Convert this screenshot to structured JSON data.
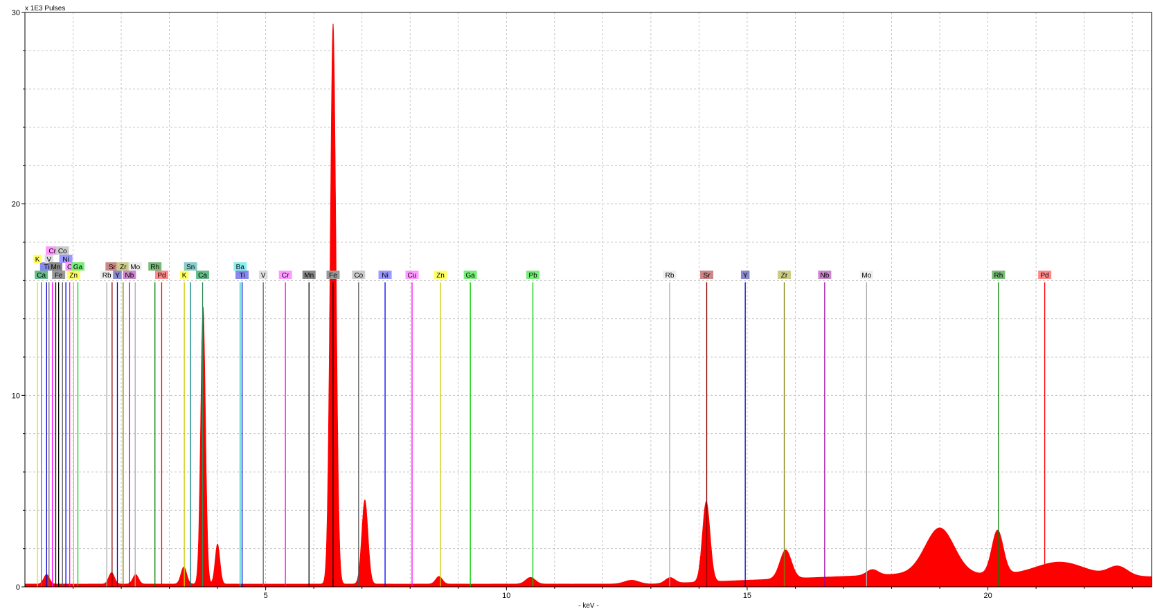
{
  "chart_data": {
    "type": "area",
    "y_unit_label": "x 1E3 Pulses",
    "xlabel": "- keV -",
    "xlim": [
      0.0,
      23.4
    ],
    "ylim": [
      0,
      30
    ],
    "x_ticks": [
      5,
      10,
      15,
      20
    ],
    "x_tick_labels": [
      "5",
      "10",
      "15",
      "20"
    ],
    "y_ticks": [
      0,
      10,
      20,
      30
    ],
    "y_tick_labels": [
      "0",
      "10",
      "20",
      "30"
    ],
    "grid": true,
    "series_color": "#ff0000",
    "spectrum": {
      "baseline": 0.15,
      "peaks": [
        {
          "x": 0.45,
          "height": 0.5,
          "width": 0.06
        },
        {
          "x": 1.8,
          "height": 0.6,
          "width": 0.06
        },
        {
          "x": 2.3,
          "height": 0.5,
          "width": 0.06
        },
        {
          "x": 3.3,
          "height": 0.9,
          "width": 0.06
        },
        {
          "x": 3.7,
          "height": 14.5,
          "width": 0.05
        },
        {
          "x": 4.0,
          "height": 2.1,
          "width": 0.05
        },
        {
          "x": 6.4,
          "height": 29.3,
          "width": 0.06
        },
        {
          "x": 7.06,
          "height": 4.4,
          "width": 0.065
        },
        {
          "x": 8.6,
          "height": 0.4,
          "width": 0.07
        },
        {
          "x": 10.5,
          "height": 0.35,
          "width": 0.1
        },
        {
          "x": 12.6,
          "height": 0.2,
          "width": 0.15
        },
        {
          "x": 13.4,
          "height": 0.3,
          "width": 0.1
        },
        {
          "x": 14.15,
          "height": 4.2,
          "width": 0.08
        },
        {
          "x": 15.8,
          "height": 1.5,
          "width": 0.12
        },
        {
          "x": 17.6,
          "height": 0.3,
          "width": 0.12
        },
        {
          "x": 19.0,
          "height": 2.4,
          "width": 0.3
        },
        {
          "x": 20.2,
          "height": 2.3,
          "width": 0.12
        },
        {
          "x": 21.5,
          "height": 0.7,
          "width": 0.5
        },
        {
          "x": 22.7,
          "height": 0.5,
          "width": 0.2
        }
      ],
      "hump": {
        "x_start": 13.0,
        "x_peak": 18.5,
        "x_end": 23.4,
        "height": 0.55
      }
    },
    "element_lines": [
      {
        "element": "Ca",
        "x": 0.34,
        "row": 3,
        "color": "#2e8b57",
        "label_bg": "#66bb88"
      },
      {
        "element": "Ti",
        "x": 0.45,
        "row": 2,
        "color": "#0000cd",
        "label_bg": "#8888ee"
      },
      {
        "element": "K",
        "x": 0.26,
        "row": 1,
        "color": "#e0e000",
        "label_bg": "#ffff66"
      },
      {
        "element": "V",
        "x": 0.5,
        "row": 1,
        "color": "#696969",
        "label_bg": "#dddddd"
      },
      {
        "element": "Cr",
        "x": 0.57,
        "row": 0,
        "color": "#ff00ff",
        "label_bg": "#ff99ff"
      },
      {
        "element": "Mn",
        "x": 0.64,
        "row": 2,
        "color": "#000000",
        "label_bg": "#888888"
      },
      {
        "element": "Fe",
        "x": 0.7,
        "row": 3,
        "color": "#000000",
        "label_bg": "#999999"
      },
      {
        "element": "Co",
        "x": 0.78,
        "row": 0,
        "color": "#555555",
        "label_bg": "#cccccc"
      },
      {
        "element": "Ni",
        "x": 0.85,
        "row": 1,
        "color": "#0000ff",
        "label_bg": "#9999ff"
      },
      {
        "element": "C",
        "x": 0.93,
        "row": 2,
        "color": "#ff00ff",
        "label_bg": "#ff99ff"
      },
      {
        "element": "Zn",
        "x": 1.01,
        "row": 3,
        "color": "#cccc00",
        "label_bg": "#ffff66"
      },
      {
        "element": "Ga",
        "x": 1.1,
        "row": 2,
        "color": "#00cc00",
        "label_bg": "#77ee77"
      },
      {
        "element": "Rb",
        "x": 1.7,
        "row": 3,
        "color": "#aaaaaa",
        "label_bg": "#eeeeee"
      },
      {
        "element": "Sr",
        "x": 1.81,
        "row": 2,
        "color": "#8b0000",
        "label_bg": "#cc8888"
      },
      {
        "element": "Y",
        "x": 1.92,
        "row": 3,
        "color": "#0000cd",
        "label_bg": "#8888cc"
      },
      {
        "element": "Zr",
        "x": 2.04,
        "row": 2,
        "color": "#808000",
        "label_bg": "#cccc88"
      },
      {
        "element": "Nb",
        "x": 2.17,
        "row": 3,
        "color": "#990099",
        "label_bg": "#cc88cc"
      },
      {
        "element": "Mo",
        "x": 2.29,
        "row": 2,
        "color": "#aaaaaa",
        "label_bg": "#eeeeee"
      },
      {
        "element": "Rh",
        "x": 2.7,
        "row": 2,
        "color": "#008000",
        "label_bg": "#77bb77"
      },
      {
        "element": "Pd",
        "x": 2.84,
        "row": 3,
        "color": "#ff0000",
        "label_bg": "#ff8888"
      },
      {
        "element": "K",
        "x": 3.31,
        "row": 3,
        "color": "#cccc00",
        "label_bg": "#ffff66"
      },
      {
        "element": "Sn",
        "x": 3.44,
        "row": 2,
        "color": "#008080",
        "label_bg": "#88cccc"
      },
      {
        "element": "Ca",
        "x": 3.69,
        "row": 3,
        "color": "#2e8b57",
        "label_bg": "#66bb88"
      },
      {
        "element": "Ba",
        "x": 4.47,
        "row": 2,
        "color": "#00cccc",
        "label_bg": "#88eeee"
      },
      {
        "element": "Ti",
        "x": 4.51,
        "row": 3,
        "color": "#0000cd",
        "label_bg": "#8888ee"
      },
      {
        "element": "V",
        "x": 4.95,
        "row": 3,
        "color": "#696969",
        "label_bg": "#dddddd"
      },
      {
        "element": "Cr",
        "x": 5.41,
        "row": 3,
        "color": "#ff00ff",
        "label_bg": "#ff99ff"
      },
      {
        "element": "Mn",
        "x": 5.9,
        "row": 3,
        "color": "#000000",
        "label_bg": "#888888"
      },
      {
        "element": "Fe",
        "x": 6.4,
        "row": 3,
        "color": "#000000",
        "label_bg": "#999999"
      },
      {
        "element": "Co",
        "x": 6.93,
        "row": 3,
        "color": "#555555",
        "label_bg": "#cccccc"
      },
      {
        "element": "Ni",
        "x": 7.48,
        "row": 3,
        "color": "#0000ff",
        "label_bg": "#9999ff"
      },
      {
        "element": "Cu",
        "x": 8.04,
        "row": 3,
        "color": "#ff00ff",
        "label_bg": "#ff99ff"
      },
      {
        "element": "Zn",
        "x": 8.63,
        "row": 3,
        "color": "#cccc00",
        "label_bg": "#ffff66"
      },
      {
        "element": "Ga",
        "x": 9.25,
        "row": 3,
        "color": "#00cc00",
        "label_bg": "#77ee77"
      },
      {
        "element": "Pb",
        "x": 10.55,
        "row": 3,
        "color": "#00cc00",
        "label_bg": "#77ee77"
      },
      {
        "element": "Rb",
        "x": 13.39,
        "row": 3,
        "color": "#aaaaaa",
        "label_bg": "#eeeeee"
      },
      {
        "element": "Sr",
        "x": 14.16,
        "row": 3,
        "color": "#8b0000",
        "label_bg": "#cc8888"
      },
      {
        "element": "Y",
        "x": 14.96,
        "row": 3,
        "color": "#0000cd",
        "label_bg": "#8888cc"
      },
      {
        "element": "Zr",
        "x": 15.77,
        "row": 3,
        "color": "#808000",
        "label_bg": "#cccc88"
      },
      {
        "element": "Nb",
        "x": 16.61,
        "row": 3,
        "color": "#990099",
        "label_bg": "#cc88cc"
      },
      {
        "element": "Mo",
        "x": 17.48,
        "row": 3,
        "color": "#aaaaaa",
        "label_bg": "#eeeeee"
      },
      {
        "element": "Rh",
        "x": 20.22,
        "row": 3,
        "color": "#008000",
        "label_bg": "#77bb77"
      },
      {
        "element": "Pd",
        "x": 21.18,
        "row": 3,
        "color": "#ff0000",
        "label_bg": "#ff8888"
      }
    ]
  }
}
